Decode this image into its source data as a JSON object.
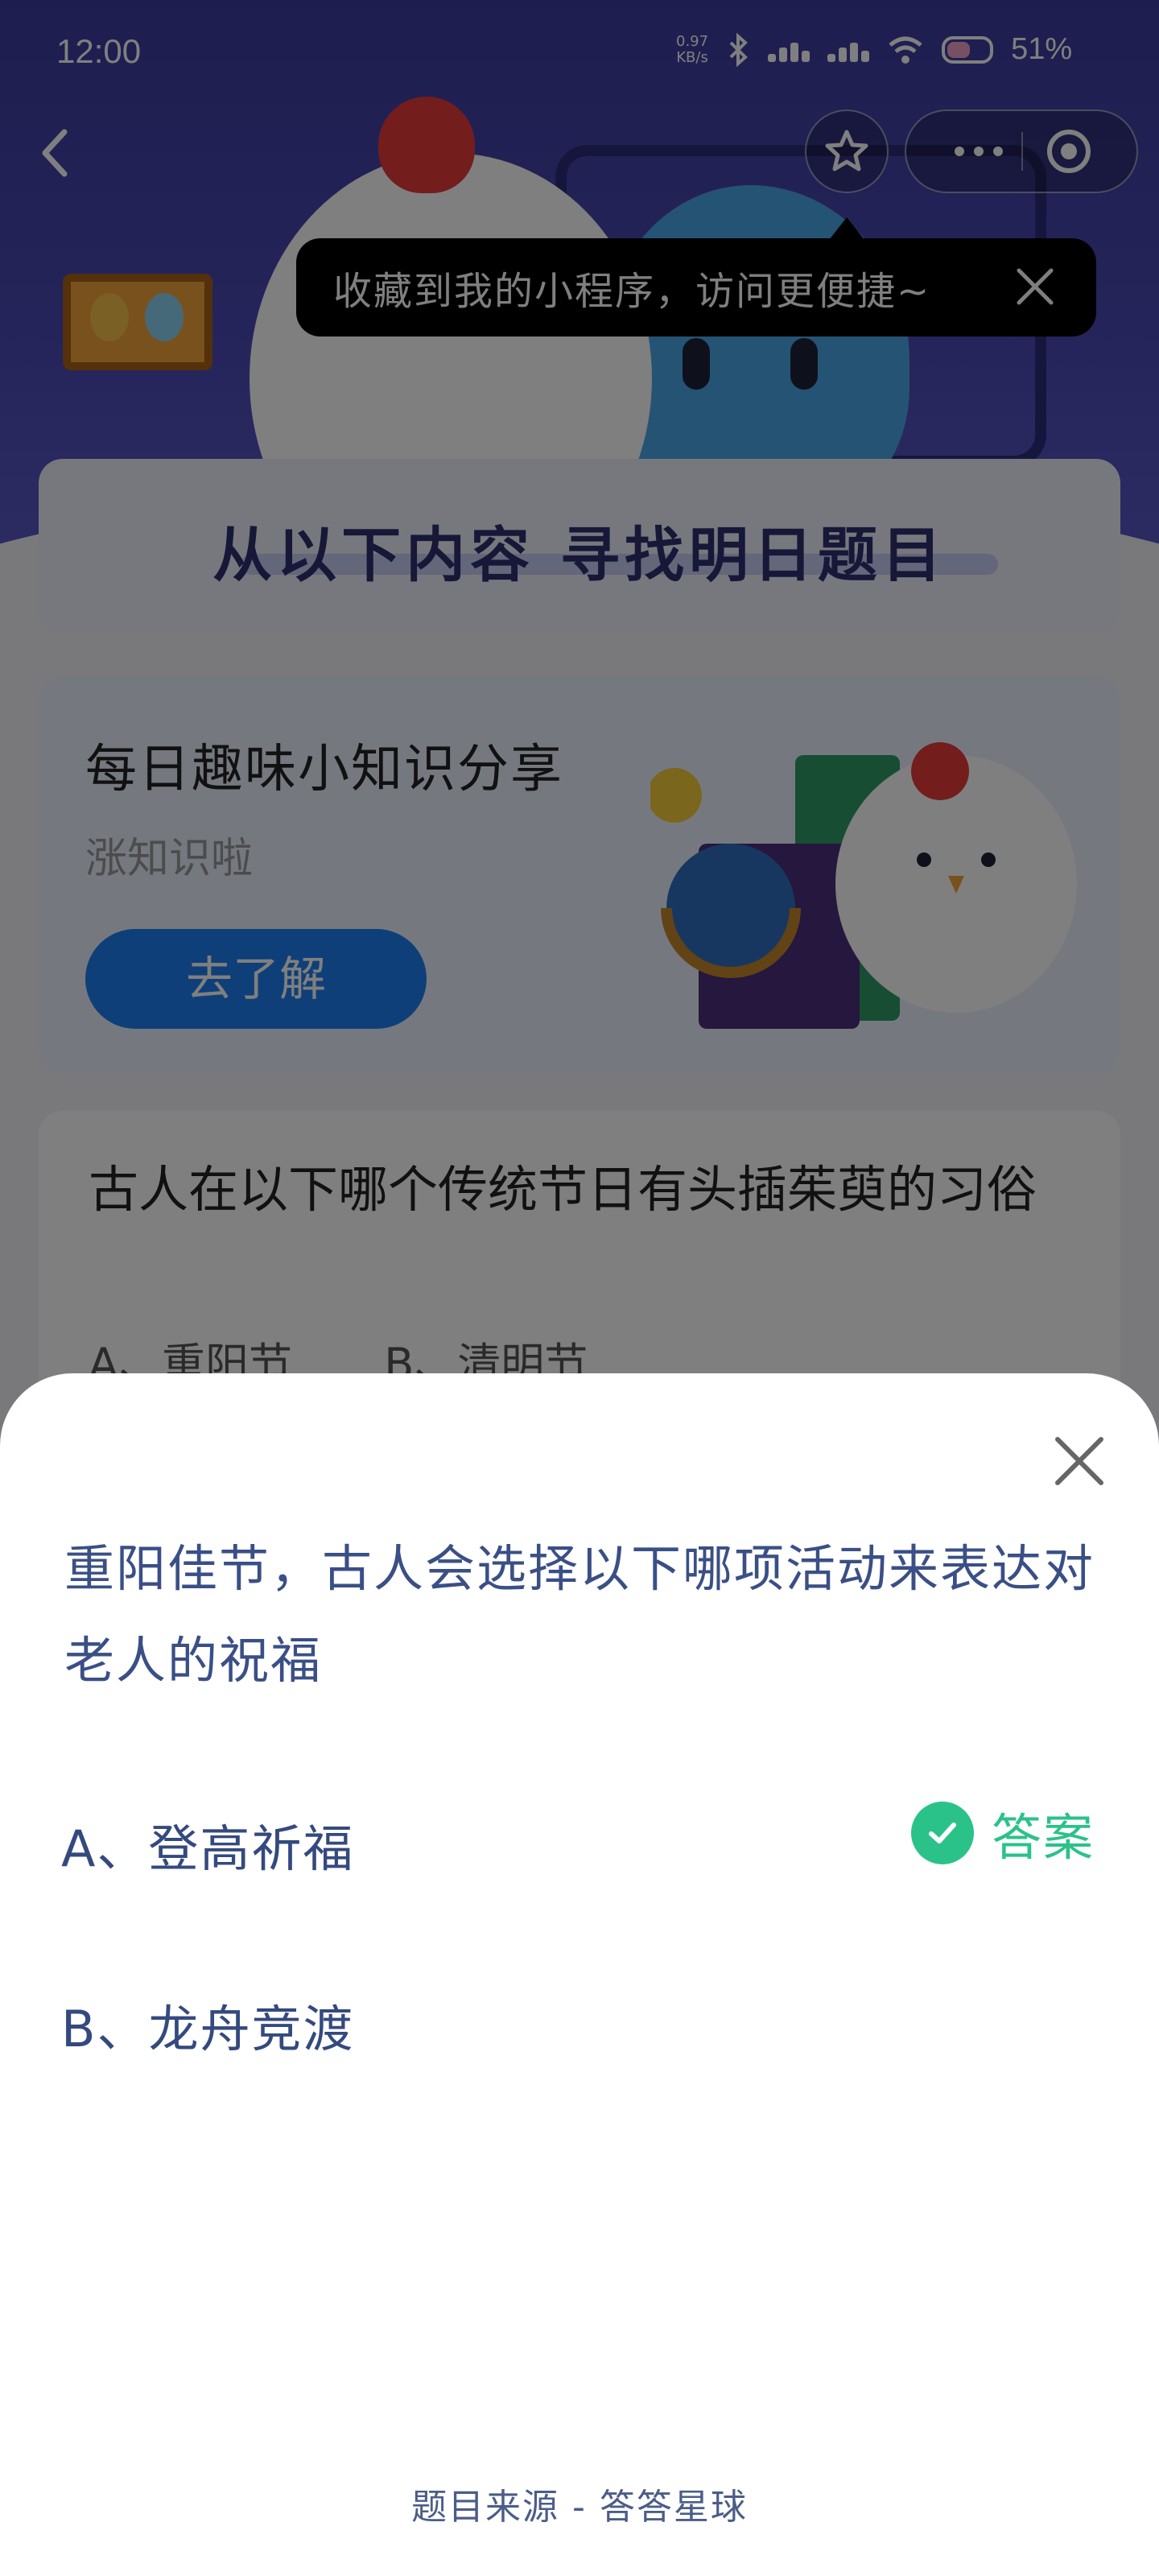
{
  "status_bar": {
    "time": "12:00",
    "net_speed_value": "0.97",
    "net_speed_unit": "KB/s",
    "battery": "51%"
  },
  "nav": {
    "back_icon": "chevron-left-icon",
    "favorite_icon": "star-icon",
    "more_icon": "more-dots-icon",
    "close_miniprogram_icon": "target-circle-icon"
  },
  "tooltip": {
    "text": "收藏到我的小程序，访问更便捷~",
    "close_icon": "close-icon"
  },
  "background": {
    "section_title": "从以下内容 寻找明日题目",
    "promo": {
      "title": "每日趣味小知识分享",
      "subtitle": "涨知识啦",
      "button": "去了解"
    },
    "question_card": {
      "text": "古人在以下哪个传统节日有头插茱萸的习俗",
      "option_a": "A、重阳节",
      "option_b": "B、清明节"
    }
  },
  "sheet": {
    "question": "重阳佳节，古人会选择以下哪项活动来表达对老人的祝福",
    "option_a": "A、登高祈福",
    "answer_label": "答案",
    "option_b": "B、龙舟竞渡",
    "source": "题目来源 - 答答星球",
    "close_icon": "close-icon",
    "answer_icon": "check-circle-icon"
  },
  "colors": {
    "hero": "#3d3b9e",
    "question_text": "#3a4f86",
    "answer_green": "#2bc28a",
    "button_blue": "#1e7ef0"
  }
}
